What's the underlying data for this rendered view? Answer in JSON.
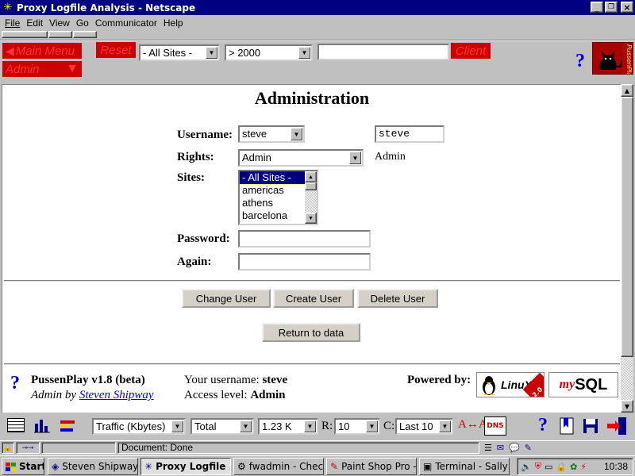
{
  "window": {
    "title": "Proxy Logfile Analysis - Netscape"
  },
  "menu": [
    "File",
    "Edit",
    "View",
    "Go",
    "Communicator",
    "Help"
  ],
  "toolbar": {
    "main_menu": "Main Menu",
    "reset": "Reset",
    "admin": "Admin",
    "sites_select": "- All Sites -",
    "threshold_select": "> 2000",
    "search_value": "",
    "client": "Client",
    "help": "?",
    "logo_text": "PussenPlay"
  },
  "main": {
    "title": "Administration",
    "username_label": "Username:",
    "username_select": "steve",
    "username_input": "steve",
    "rights_label": "Rights:",
    "rights_select": "Admin",
    "rights_value": "Admin",
    "sites_label": "Sites:",
    "sites_options": [
      "- All Sites -",
      "americas",
      "athens",
      "barcelona"
    ],
    "password_label": "Password:",
    "again_label": "Again:",
    "change_user": "Change User",
    "create_user": "Create User",
    "delete_user": "Delete User",
    "return_to_data": "Return to data"
  },
  "footer": {
    "help": "?",
    "product": "PussenPlay v1.8 (beta)",
    "admin_by": "Admin by",
    "author": "Steven Shipway",
    "your_username_label": "Your username:",
    "your_username": "steve",
    "access_label": "Access level:",
    "access": "Admin",
    "powered_by": "Powered by:",
    "linux": "LinuX",
    "linux_badge": "2.0",
    "mysql_my": "my",
    "mysql_sql": "SQL"
  },
  "bottom_toolbar": {
    "metric": "Traffic (Kbytes)",
    "agg": "Total",
    "size": "1.23 K",
    "r_label": "R:",
    "r_value": "10",
    "c_label": "C:",
    "c_value": "Last 10",
    "dns": "DNS",
    "help": "?",
    "font_label": "A↔A"
  },
  "status": {
    "text": "Document: Done"
  },
  "taskbar": {
    "start": "Start",
    "tasks": [
      "Steven Shipway ...",
      "Proxy Logfile ...",
      "fwadmin - Check...",
      "Paint Shop Pro - ...",
      "Terminal - Sally (..."
    ],
    "clock": "10:38"
  }
}
